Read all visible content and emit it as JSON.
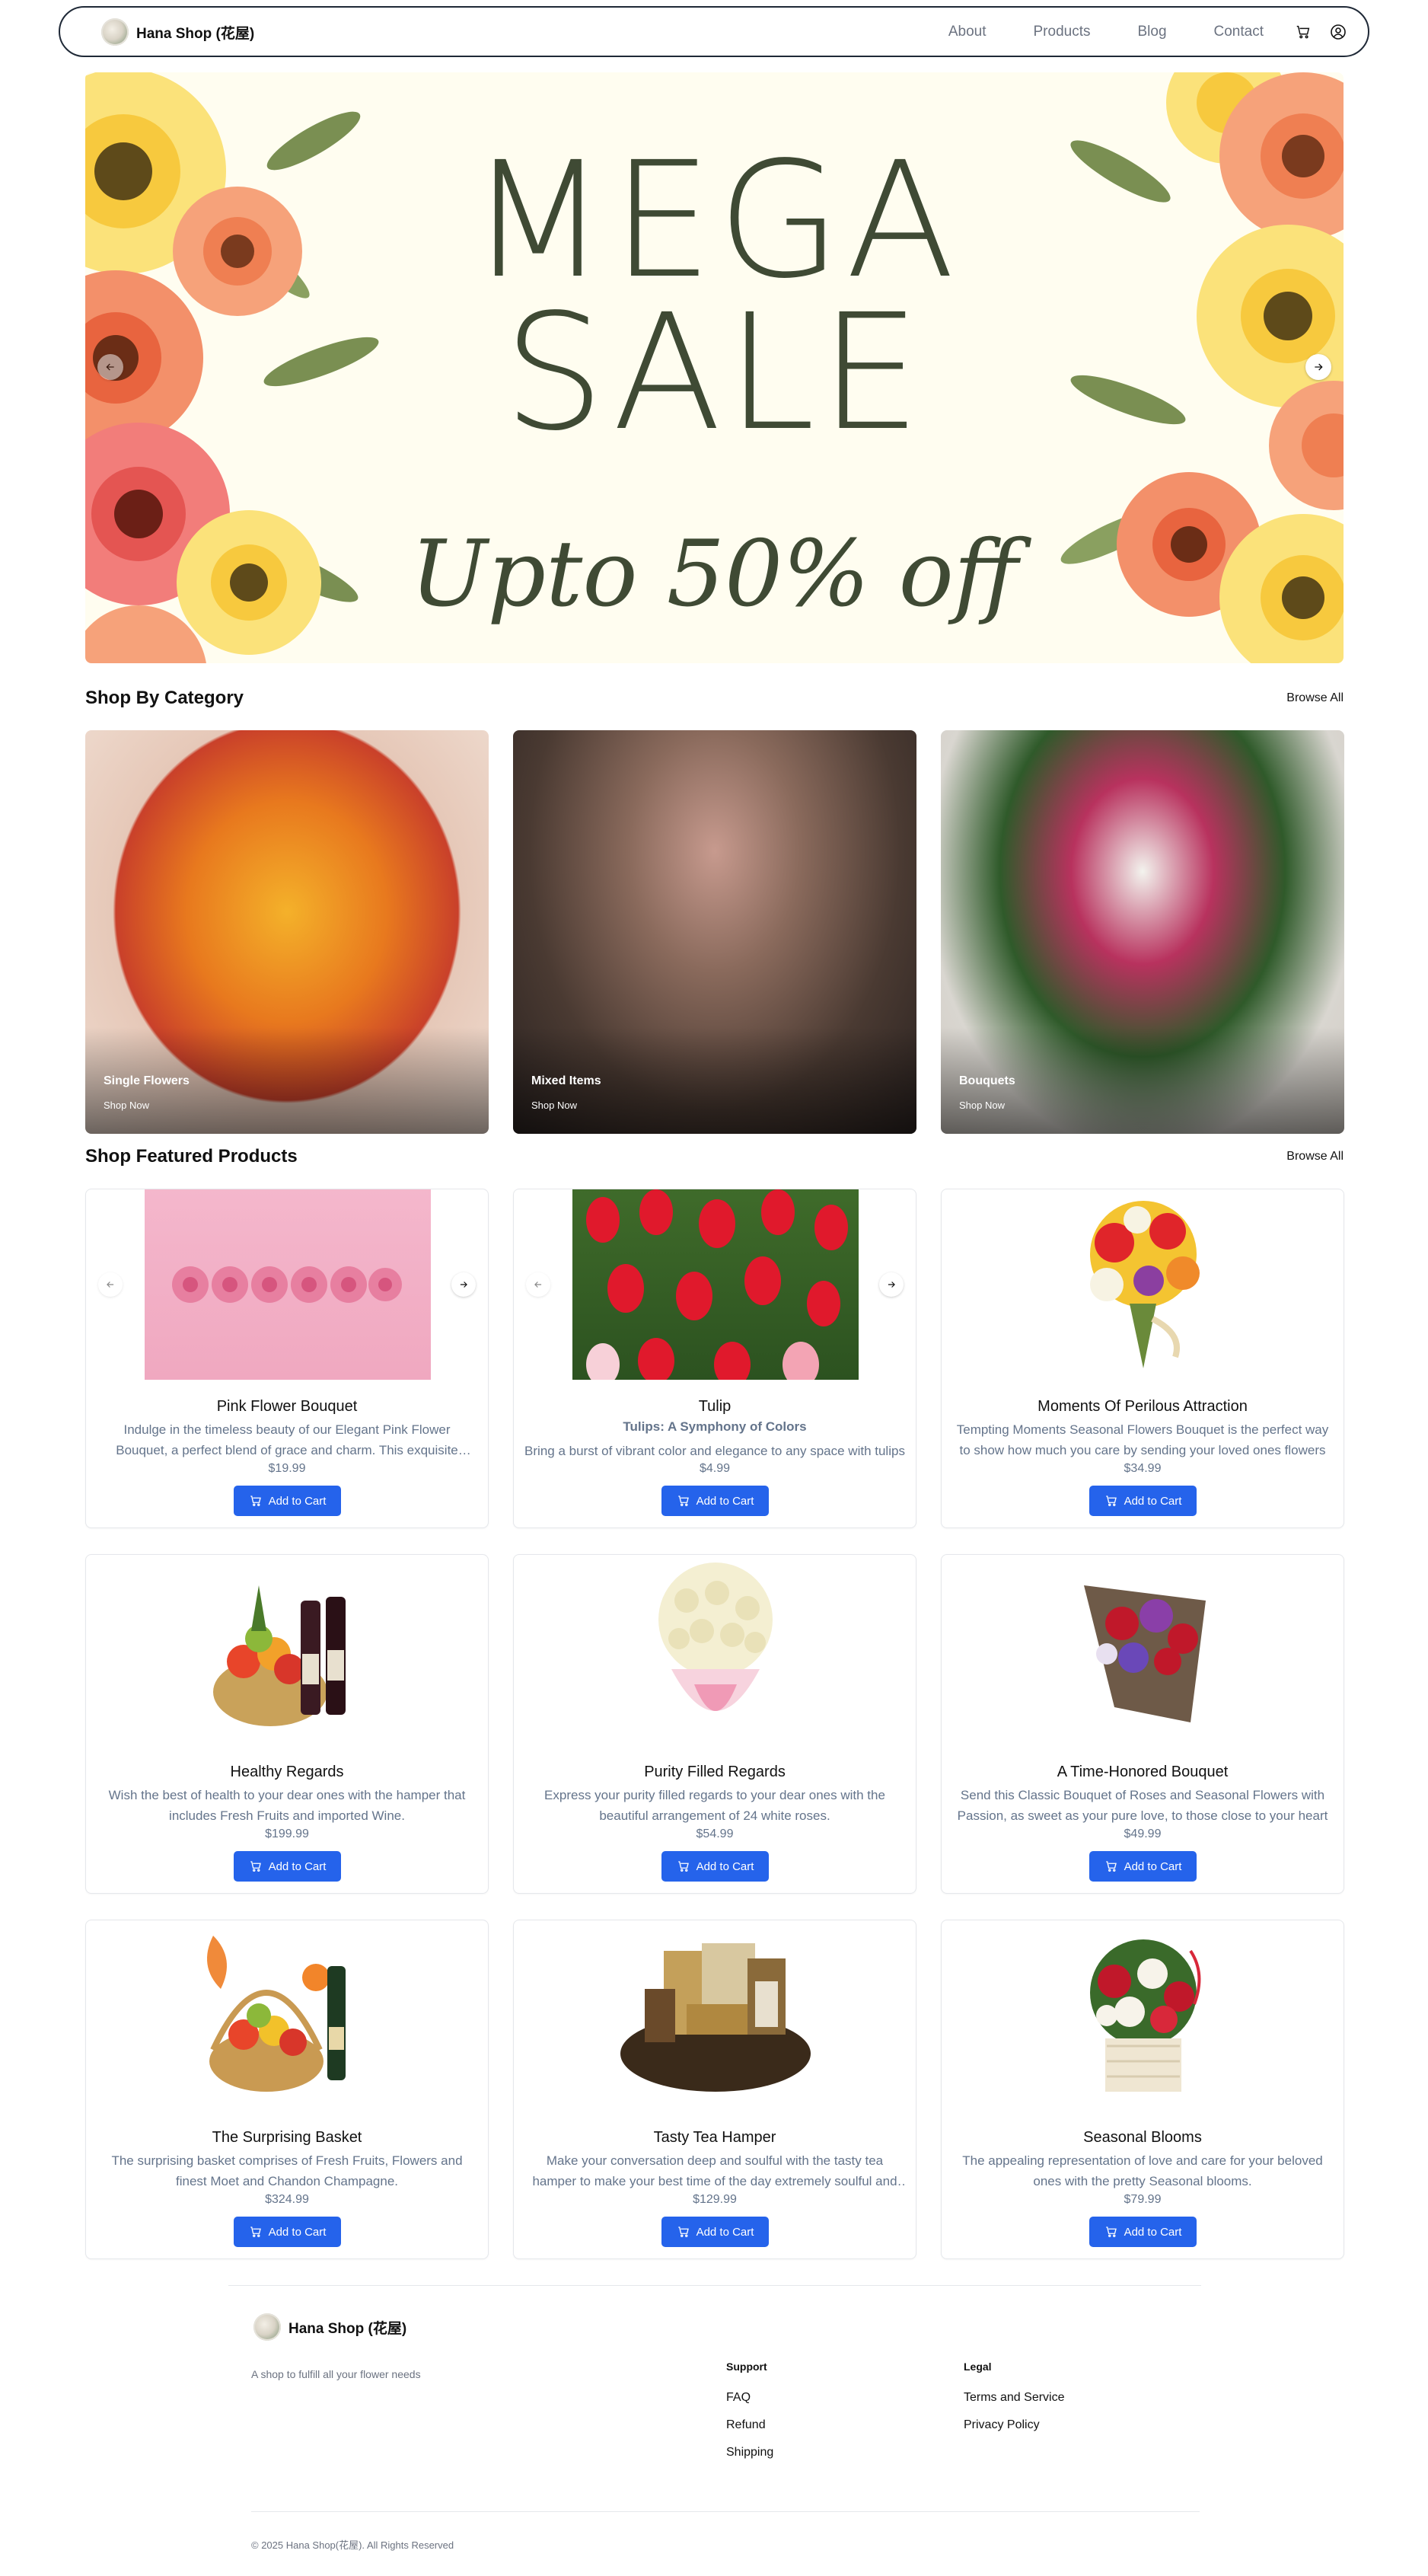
{
  "nav": {
    "brand": "Hana Shop (花屋)",
    "links": [
      "About",
      "Products",
      "Blog",
      "Contact"
    ],
    "cart_icon": "cart-icon",
    "user_icon": "user-icon"
  },
  "hero": {
    "title_line1": "MEGA",
    "title_line2": "SALE",
    "subtitle": "Upto 50% off"
  },
  "categories": {
    "title": "Shop By Category",
    "browse": "Browse All",
    "items": [
      {
        "label": "Single Flowers",
        "link": "Shop Now"
      },
      {
        "label": "Mixed Items",
        "link": "Shop Now"
      },
      {
        "label": "Bouquets",
        "link": "Shop Now"
      }
    ]
  },
  "products": {
    "title": "Shop Featured Products",
    "browse": "Browse All",
    "add_to_cart": "Add to Cart",
    "items": [
      {
        "name": "Pink Flower Bouquet",
        "tag": "",
        "desc": "Indulge in the timeless beauty of our Elegant Pink Flower Bouquet, a perfect blend of grace and charm. This exquisite arrangement",
        "price": "$19.99"
      },
      {
        "name": "Tulip",
        "tag": "Tulips: A Symphony of Colors",
        "desc": "Bring a burst of vibrant color and elegance to any space with tulips",
        "price": "$4.99"
      },
      {
        "name": "Moments Of Perilous Attraction",
        "tag": "",
        "desc": "Tempting Moments Seasonal Flowers Bouquet is the perfect way to show how much you care by sending your loved ones flowers",
        "price": "$34.99"
      },
      {
        "name": "Healthy Regards",
        "tag": "",
        "desc": "Wish the best of health to your dear ones with the hamper that includes Fresh Fruits and imported Wine.",
        "price": "$199.99"
      },
      {
        "name": "Purity Filled Regards",
        "tag": "",
        "desc": "Express your purity filled regards to your dear ones with the beautiful arrangement of 24 white roses.",
        "price": "$54.99"
      },
      {
        "name": "A Time-Honored Bouquet",
        "tag": "",
        "desc": "Send this Classic Bouquet of Roses and Seasonal Flowers with Passion, as sweet as your pure love, to those close to your heart",
        "price": "$49.99"
      },
      {
        "name": "The Surprising Basket",
        "tag": "",
        "desc": "The surprising basket comprises of Fresh Fruits, Flowers and finest Moet and Chandon Champagne.",
        "price": "$324.99"
      },
      {
        "name": "Tasty Tea Hamper",
        "tag": "",
        "desc": "Make your conversation deep and soulful with the tasty tea hamper to make your best time of the day extremely soulful and lively",
        "price": "$129.99"
      },
      {
        "name": "Seasonal Blooms",
        "tag": "",
        "desc": "The appealing representation of love and care for your beloved ones with the pretty Seasonal blooms.",
        "price": "$79.99"
      }
    ]
  },
  "footer": {
    "brand": "Hana Shop (花屋)",
    "tagline": "A shop to fulfill all your flower needs",
    "support_title": "Support",
    "support_links": [
      "FAQ",
      "Refund",
      "Shipping"
    ],
    "legal_title": "Legal",
    "legal_links": [
      "Terms and Service",
      "Privacy Policy"
    ],
    "copyright": "© 2025 Hana Shop(花屋). All Rights Reserved"
  },
  "colors": {
    "accent": "#2563eb",
    "muted_text": "#64748b",
    "hero_bg": "#fffdf0",
    "hero_text": "#3f4a34"
  }
}
